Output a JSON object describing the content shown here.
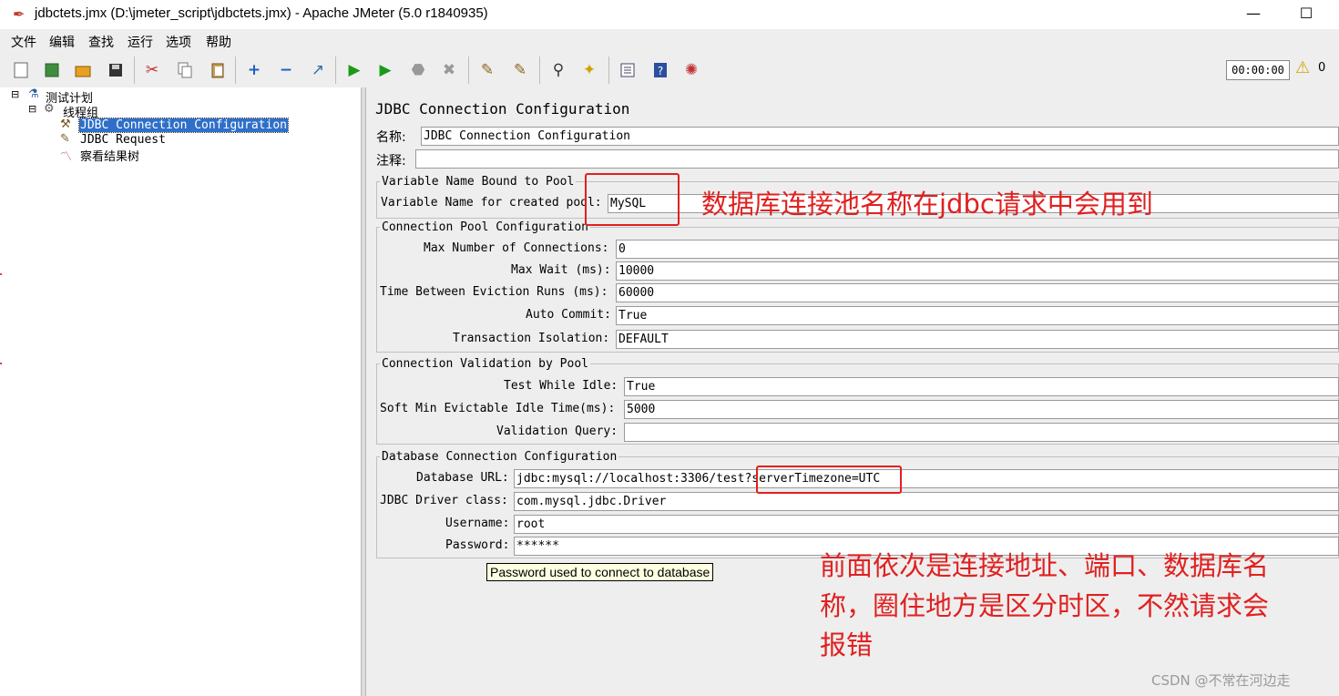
{
  "window": {
    "title": "jdbctets.jmx (D:\\jmeter_script\\jdbctets.jmx) - Apache JMeter (5.0 r1840935)",
    "minimize_glyph": "—",
    "maximize_glyph": "☐"
  },
  "menu": [
    "文件",
    "编辑",
    "查找",
    "运行",
    "选项",
    "帮助"
  ],
  "toolbar": {
    "icons": [
      "new-icon",
      "templates-icon",
      "open-icon",
      "save-icon",
      "cut-icon",
      "copy-icon",
      "paste-icon",
      "expand-icon",
      "collapse-icon",
      "toggle-icon",
      "start-icon",
      "start-no-pause-icon",
      "stop-icon",
      "shutdown-icon",
      "remote-clear-icon",
      "clear-all-icon",
      "search-icon",
      "reset-search-icon",
      "function-helper-icon",
      "help-icon",
      "remote-start-icon"
    ],
    "timer": "00:00:00",
    "warning_count": "0"
  },
  "tree": {
    "root": "测试计划",
    "thread_group": "线程组",
    "children": [
      "JDBC Connection Configuration",
      "JDBC Request",
      "察看结果树"
    ]
  },
  "panel": {
    "title": "JDBC Connection Configuration",
    "name_label": "名称:",
    "name_value": "JDBC Connection Configuration",
    "comment_label": "注释:",
    "comment_value": "",
    "pool_group": {
      "title": "Variable Name Bound to Pool",
      "var_label": "Variable Name for created pool:",
      "var_value": "MySQL"
    },
    "pool_config": {
      "title": "Connection Pool Configuration",
      "rows": [
        {
          "label": "Max Number of Connections:",
          "value": "0"
        },
        {
          "label": "Max Wait (ms):",
          "value": "10000"
        },
        {
          "label": "Time Between Eviction Runs (ms):",
          "value": "60000"
        },
        {
          "label": "Auto Commit:",
          "value": "True"
        },
        {
          "label": "Transaction Isolation:",
          "value": "DEFAULT"
        }
      ]
    },
    "validation": {
      "title": "Connection Validation by Pool",
      "rows": [
        {
          "label": "Test While Idle:",
          "value": "True"
        },
        {
          "label": "Soft Min Evictable Idle Time(ms):",
          "value": "5000"
        },
        {
          "label": "Validation Query:",
          "value": ""
        }
      ]
    },
    "db_config": {
      "title": "Database Connection Configuration",
      "rows": [
        {
          "label": "Database URL:",
          "value": "jdbc:mysql://localhost:3306/test?serverTimezone=UTC"
        },
        {
          "label": "JDBC Driver class:",
          "value": "com.mysql.jdbc.Driver"
        },
        {
          "label": "Username:",
          "value": "root"
        },
        {
          "label": "Password:",
          "value": "******"
        }
      ]
    },
    "tooltip": "Password used to connect to database"
  },
  "annotations": {
    "pool_note": "数据库连接池名称在jdbc请求中会用到",
    "url_note_lines": [
      "前面依次是连接地址、端口、数据库名",
      "称，圈住地方是区分时区，不然请求会",
      "报错"
    ],
    "accent_color": "#e02020"
  },
  "watermark": "CSDN @不常在河边走"
}
